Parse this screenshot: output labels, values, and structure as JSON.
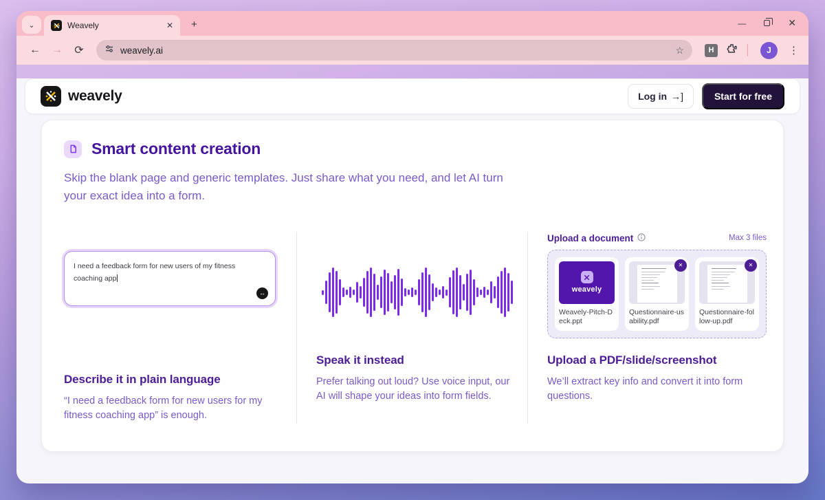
{
  "browser": {
    "tab_title": "Weavely",
    "url": "weavely.ai",
    "extension_badge": "H",
    "profile_initial": "J",
    "new_tab_glyph": "+",
    "close_tab_glyph": "✕",
    "back_glyph": "←",
    "forward_glyph": "→",
    "reload_glyph": "⟳",
    "star_glyph": "☆",
    "menu_glyph": "⋮",
    "tab_search_glyph": "⌄",
    "minimize_glyph": "—",
    "close_window_glyph": "✕"
  },
  "header": {
    "brand": "weavely",
    "login_label": "Log in",
    "login_icon": "→]",
    "cta_label": "Start for free"
  },
  "main": {
    "title": "Smart content creation",
    "subtitle": "Skip the blank page and generic templates. Just share what you need, and let AI turn your exact idea into a form.",
    "describe": {
      "input_value": "I need a feedback form for new users of my fitness coaching app",
      "action_glyph": "↔",
      "heading": "Describe it in plain language",
      "body": "“I need a feedback form for new users for my fitness coaching app” is enough."
    },
    "speak": {
      "heading": "Speak it instead",
      "body": "Prefer talking out loud? Use voice input, our AI will shape your ideas into form fields.",
      "waveform_color": "#7c2ce8",
      "waveform": [
        7,
        34,
        58,
        72,
        62,
        38,
        14,
        8,
        16,
        8,
        30,
        18,
        42,
        62,
        72,
        54,
        22,
        46,
        66,
        56,
        32,
        50,
        68,
        40,
        12,
        8,
        14,
        8,
        38,
        58,
        72,
        52,
        26,
        14,
        8,
        18,
        9,
        44,
        64,
        72,
        50,
        24,
        54,
        66,
        38,
        14,
        8,
        16,
        8,
        32,
        18,
        46,
        62,
        72,
        56,
        34
      ]
    },
    "upload": {
      "label": "Upload a document",
      "max_files": "Max 3 files",
      "heading": "Upload a PDF/slide/screenshot",
      "body": "We’ll extract key info and convert it into form questions.",
      "remove_glyph": "✕",
      "files": [
        {
          "name": "Weavely-Pitch-Deck.ppt",
          "thumb_brand": "weavely"
        },
        {
          "name": "Questionnaire-usability.pdf"
        },
        {
          "name": "Questionnaire-follow-up.pdf"
        }
      ]
    }
  },
  "colors": {
    "heading_purple": "#4c1d95",
    "body_purple": "#7a5ac6",
    "accent_purple": "#7c2ce8",
    "cta_background": "#211339",
    "browser_pink": "#fcdbe0",
    "tabstrip_pink": "#f8bdc8"
  }
}
